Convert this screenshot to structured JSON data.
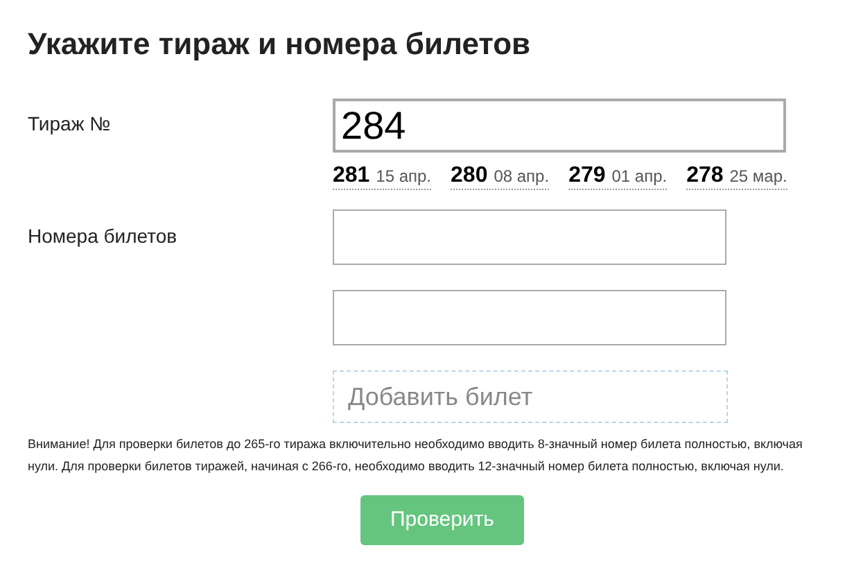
{
  "title": "Укажите тираж и номера билетов",
  "draw": {
    "label": "Тираж №",
    "value": "284",
    "recent": [
      {
        "number": "281",
        "date": "15 апр."
      },
      {
        "number": "280",
        "date": "08 апр."
      },
      {
        "number": "279",
        "date": "01 апр."
      },
      {
        "number": "278",
        "date": "25 мар."
      }
    ]
  },
  "tickets": {
    "label": "Номера билетов",
    "fields": [
      {
        "kind": "input"
      },
      {
        "kind": "input"
      }
    ],
    "add_placeholder": "Добавить билет"
  },
  "notice": "Внимание! Для проверки билетов до 265-го тиража включительно необходимо вводить 8-значный номер билета полностью, включая нули. Для проверки билетов тиражей, начиная с 266-го, необходимо вводить 12-значный номер билета полностью, включая нули.",
  "submit": "Проверить"
}
